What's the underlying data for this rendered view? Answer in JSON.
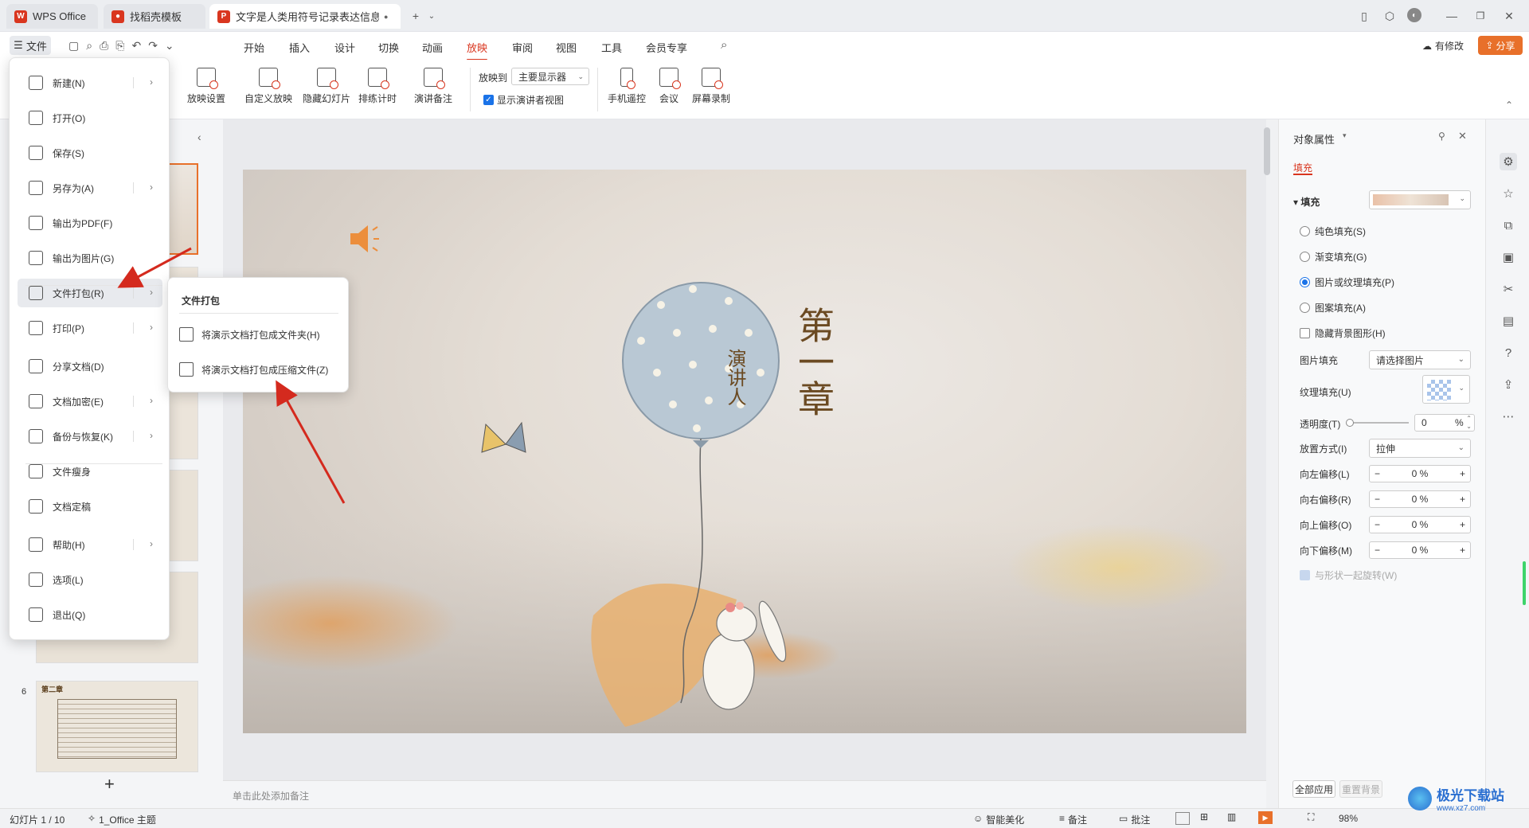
{
  "tabs": [
    {
      "label": "WPS Office",
      "active": false
    },
    {
      "label": "找稻壳模板",
      "active": false
    },
    {
      "label": "文字是人类用符号记录表达信息以",
      "active": true
    }
  ],
  "header": {
    "file_menu": "文件",
    "modified": "有修改",
    "share": "分享"
  },
  "menus": [
    "开始",
    "插入",
    "设计",
    "切换",
    "动画",
    "放映",
    "审阅",
    "视图",
    "工具",
    "会员专享"
  ],
  "active_menu": "放映",
  "ribbon": {
    "buttons": [
      "放映设置",
      "自定义放映",
      "隐藏幻灯片",
      "排练计时",
      "演讲备注"
    ],
    "play_to_label": "放映到",
    "play_to_value": "主要显示器",
    "presenter_view": "显示演讲者视图",
    "right_buttons": [
      "手机遥控",
      "会议",
      "屏幕录制"
    ]
  },
  "file_menu": {
    "items": [
      {
        "label": "新建(N)",
        "chevron": true
      },
      {
        "label": "打开(O)",
        "chevron": false
      },
      {
        "label": "保存(S)",
        "chevron": false
      },
      {
        "label": "另存为(A)",
        "chevron": true
      },
      {
        "label": "输出为PDF(F)",
        "chevron": false
      },
      {
        "label": "输出为图片(G)",
        "chevron": false
      },
      {
        "label": "文件打包(R)",
        "chevron": true
      },
      {
        "label": "打印(P)",
        "chevron": true
      },
      {
        "label": "分享文档(D)",
        "chevron": false
      },
      {
        "label": "文档加密(E)",
        "chevron": true
      },
      {
        "label": "备份与恢复(K)",
        "chevron": true
      },
      {
        "label": "文件瘦身",
        "chevron": false
      },
      {
        "label": "文档定稿",
        "chevron": false
      },
      {
        "label": "帮助(H)",
        "chevron": true
      },
      {
        "label": "选项(L)",
        "chevron": false
      },
      {
        "label": "退出(Q)",
        "chevron": false
      }
    ]
  },
  "submenu": {
    "title": "文件打包",
    "items": [
      "将演示文档打包成文件夹(H)",
      "将演示文档打包成压缩文件(Z)"
    ]
  },
  "thumbs": {
    "slide6_number": "6",
    "slide6_title": "第二章",
    "add": "+"
  },
  "slide": {
    "title": "第一章",
    "subtitle": "演讲人"
  },
  "notes_placeholder": "单击此处添加备注",
  "props": {
    "title": "对象属性",
    "tab": "填充",
    "section": "填充",
    "options": [
      "纯色填充(S)",
      "渐变填充(G)",
      "图片或纹理填充(P)",
      "图案填充(A)"
    ],
    "selected_option": "图片或纹理填充(P)",
    "hide_bg": "隐藏背景图形(H)",
    "pic_fill_label": "图片填充",
    "pic_fill_value": "请选择图片",
    "texture_label": "纹理填充(U)",
    "transparency_label": "透明度(T)",
    "transparency_value": "0",
    "transparency_unit": "%",
    "placement_label": "放置方式(I)",
    "placement_value": "拉伸",
    "offsets": [
      {
        "label": "向左偏移(L)",
        "value": "0 %"
      },
      {
        "label": "向右偏移(R)",
        "value": "0 %"
      },
      {
        "label": "向上偏移(O)",
        "value": "0 %"
      },
      {
        "label": "向下偏移(M)",
        "value": "0 %"
      }
    ],
    "rotate_with_shape": "与形状一起旋转(W)",
    "apply_all": "全部应用",
    "reset_bg": "重置背景"
  },
  "status": {
    "slide_info": "幻灯片 1 / 10",
    "theme": "1_Office 主题",
    "beautify": "智能美化",
    "notes": "备注",
    "comments": "批注",
    "zoom": "98%"
  },
  "watermark": {
    "text": "极光下载站",
    "url": "www.xz7.com"
  },
  "colors": {
    "accent": "#d9361f",
    "title_brown": "#6b4a22",
    "balloon": "#b9c8d4"
  }
}
